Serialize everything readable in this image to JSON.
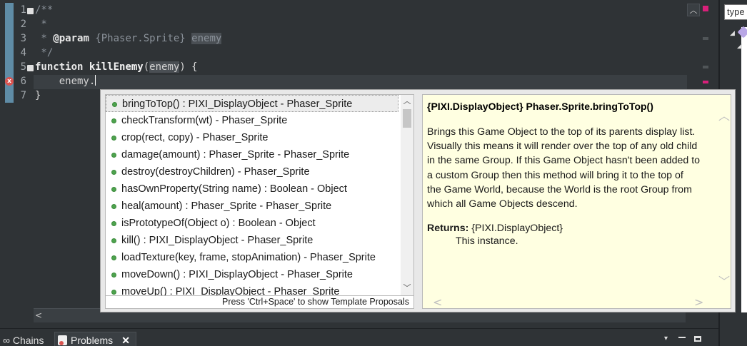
{
  "editor": {
    "line_numbers": [
      "1",
      "2",
      "3",
      "4",
      "5",
      "6",
      "7"
    ],
    "lines": [
      {
        "comment": "/**"
      },
      {
        "comment": " *"
      },
      {
        "tag_prefix": " * ",
        "tag": "@param",
        "type": " {Phaser.Sprite} ",
        "param": "enemy"
      },
      {
        "comment": " */"
      },
      {
        "keyword": "function",
        "fname": "killEnemy",
        "open": "(",
        "arg": "enemy",
        "close": ") {"
      },
      {
        "code": "    enemy."
      },
      {
        "code": "}"
      }
    ],
    "error_marker": "x"
  },
  "completion": {
    "proposals": [
      "bringToTop() : PIXI_DisplayObject - Phaser_Sprite",
      "checkTransform(wt) - Phaser_Sprite",
      "crop(rect, copy) - Phaser_Sprite",
      "damage(amount) : Phaser_Sprite - Phaser_Sprite",
      "destroy(destroyChildren) - Phaser_Sprite",
      "hasOwnProperty(String name) : Boolean - Object",
      "heal(amount) : Phaser_Sprite - Phaser_Sprite",
      "isPrototypeOf(Object o) : Boolean - Object",
      "kill() : PIXI_DisplayObject - Phaser_Sprite",
      "loadTexture(key, frame, stopAnimation) - Phaser_Sprite",
      "moveDown() : PIXI_DisplayObject - Phaser_Sprite",
      "moveUp() : PIXI_DisplayObject - Phaser_Sprite"
    ],
    "selected_index": 0,
    "status_hint": "Press 'Ctrl+Space' to show Template Proposals"
  },
  "docs": {
    "header": "{PIXI.DisplayObject} Phaser.Sprite.bringToTop()",
    "body_lines": [
      "Brings this Game Object to the top of its parents display list.",
      "Visually this means it will render over the top of any old child",
      "in the same Group. If this Game Object hasn't been added to",
      "a custom Group then this method will bring it to the top of",
      "the Game World, because the World is the root Group from",
      "which all Game Objects descend."
    ],
    "returns_label": "Returns:",
    "returns_type": "{PIXI.DisplayObject}",
    "returns_desc": "This instance."
  },
  "right_panel": {
    "filter_value": "type"
  },
  "bottom_tabs": {
    "chains_label": "Chains",
    "problems_label": "Problems",
    "close_glyph": "✕"
  },
  "colors": {
    "editor_bg": "#2f3336",
    "doc_bg": "#ffffe1",
    "method_dot": "#4ea34e",
    "error": "#d9534f"
  }
}
